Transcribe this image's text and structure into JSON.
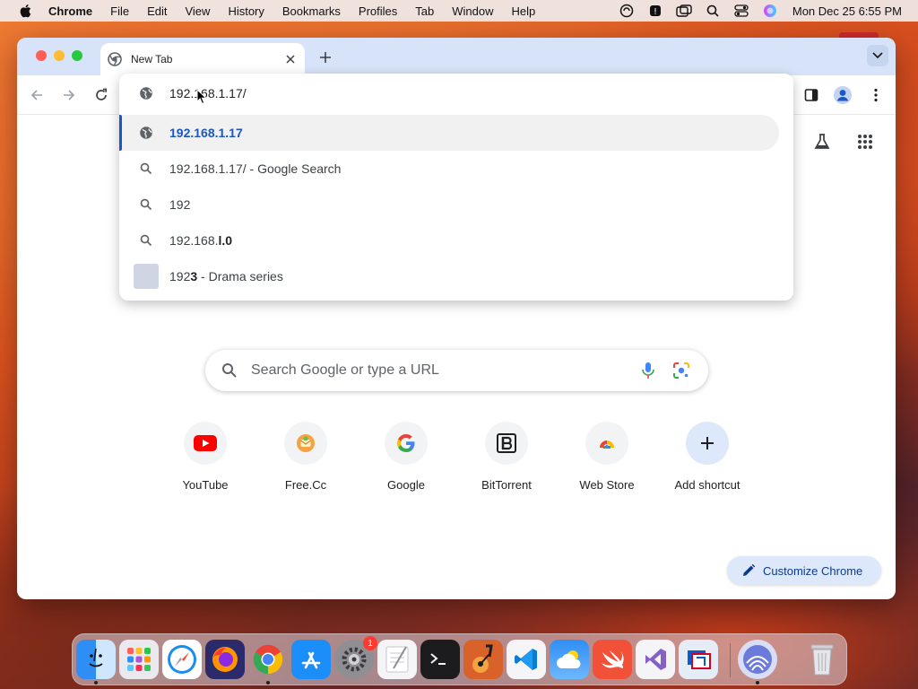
{
  "menubar": {
    "app_name": "Chrome",
    "items": [
      "File",
      "Edit",
      "View",
      "History",
      "Bookmarks",
      "Profiles",
      "Tab",
      "Window",
      "Help"
    ],
    "clock": "Mon Dec 25  6:55 PM"
  },
  "browser": {
    "tab_title": "New Tab",
    "omnibox": {
      "input_text": "192.168.1.17/",
      "suggestions": [
        {
          "icon": "globe-icon",
          "text": "192.168.1.17",
          "selected": true
        },
        {
          "icon": "search-icon",
          "text": "192.168.1.17/ - Google Search"
        },
        {
          "icon": "search-icon",
          "text": "192"
        },
        {
          "icon": "search-icon",
          "text_prefix": "192.168.",
          "text_bold": "l.0"
        },
        {
          "icon": "thumbnail",
          "text_prefix": "192",
          "text_bold": "3",
          "text_suffix": " - Drama series"
        }
      ]
    }
  },
  "ntp": {
    "search_placeholder": "Search Google or type a URL",
    "shortcuts": [
      {
        "label": "YouTube",
        "icon": "youtube-icon"
      },
      {
        "label": "Free.Cc",
        "icon": "freecc-icon"
      },
      {
        "label": "Google",
        "icon": "google-icon"
      },
      {
        "label": "BitTorrent",
        "icon": "bittorrent-icon"
      },
      {
        "label": "Web Store",
        "icon": "webstore-icon"
      },
      {
        "label": "Add shortcut",
        "icon": "plus-icon"
      }
    ],
    "customize_label": "Customize Chrome"
  },
  "dock": {
    "items": [
      "Finder",
      "Launchpad",
      "Safari",
      "Firefox",
      "Chrome",
      "App Store",
      "System Settings",
      "TextEdit",
      "Terminal",
      "GarageBand",
      "Visual Studio Code",
      "Weather",
      "Swift",
      "Visual Studio",
      "Remote Desktop",
      "BitTorrent",
      "Trash"
    ],
    "settings_badge": "1"
  },
  "colors": {
    "accent": "#1a56c4",
    "tabstrip": "#d7e3f8",
    "customize_bg": "#dde8fb"
  }
}
